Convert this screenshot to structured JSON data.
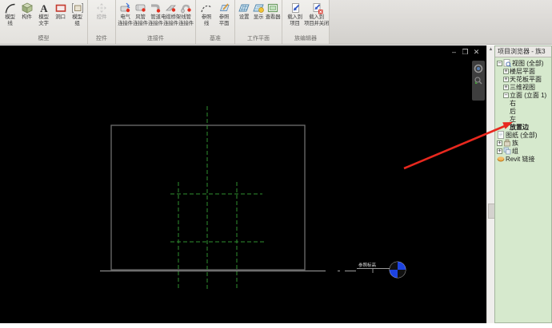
{
  "colors": {
    "annotation_red": "#e8281e",
    "reference_plane_green": "#2f8f2f",
    "geometry_gray": "#6f6f6f",
    "level_line_gray": "#8a8a8a",
    "level_head_blue": "#1d43e0",
    "canvas_background": "#000000",
    "browser_background": "#d6e9cd"
  },
  "ribbon": {
    "panels": [
      {
        "label": "模型",
        "buttons": [
          {
            "icon": "model-line",
            "lines": [
              "模型",
              "线"
            ]
          },
          {
            "icon": "component",
            "lines": [
              "构件"
            ]
          },
          {
            "icon": "model-text",
            "lines": [
              "模型",
              "文字"
            ]
          },
          {
            "icon": "opening",
            "lines": [
              "洞口"
            ]
          },
          {
            "icon": "model-group",
            "lines": [
              "模型",
              "组"
            ]
          }
        ]
      },
      {
        "label": "控件",
        "buttons": [
          {
            "icon": "control",
            "lines": [
              "控件"
            ],
            "disabled": true
          }
        ]
      },
      {
        "label": "连接件",
        "buttons": [
          {
            "icon": "elec-connector",
            "lines": [
              "电气",
              "连接件"
            ]
          },
          {
            "icon": "duct-connector",
            "lines": [
              "风管",
              "连接件"
            ]
          },
          {
            "icon": "pipe-connector",
            "lines": [
              "管道",
              "连接件"
            ]
          },
          {
            "icon": "cable-tray-connector",
            "lines": [
              "电缆桥架",
              "连接件"
            ]
          },
          {
            "icon": "conduit-connector",
            "lines": [
              "线管",
              "连接件"
            ]
          }
        ]
      },
      {
        "label": "基准",
        "buttons": [
          {
            "icon": "ref-line",
            "lines": [
              "参照",
              "线"
            ]
          },
          {
            "icon": "ref-plane",
            "lines": [
              "参照",
              "平面"
            ]
          }
        ]
      },
      {
        "label": "工作平面",
        "buttons": [
          {
            "icon": "wp-set",
            "lines": [
              "设置"
            ]
          },
          {
            "icon": "wp-show",
            "lines": [
              "显示"
            ]
          },
          {
            "icon": "wp-viewer",
            "lines": [
              "查看器"
            ]
          }
        ]
      },
      {
        "label": "族编辑器",
        "buttons": [
          {
            "icon": "load-project",
            "lines": [
              "载入到",
              "项目"
            ]
          },
          {
            "icon": "load-close",
            "lines": [
              "载入到",
              "项目并关闭"
            ]
          }
        ]
      }
    ]
  },
  "canvas": {
    "window_controls": [
      {
        "name": "minimize",
        "glyph": "–"
      },
      {
        "name": "restore",
        "glyph": "❐"
      },
      {
        "name": "close",
        "glyph": "✕"
      }
    ],
    "level": {
      "name": "参照标高"
    }
  },
  "browser": {
    "title": "项目浏览器 - 族3",
    "tree": [
      {
        "indent": 0,
        "expander": "minus",
        "icon": "views",
        "label": "视图 (全部)",
        "bold": false
      },
      {
        "indent": 1,
        "expander": "plus",
        "icon": null,
        "label": "楼层平面",
        "bold": false
      },
      {
        "indent": 1,
        "expander": "plus",
        "icon": null,
        "label": "天花板平面",
        "bold": false
      },
      {
        "indent": 1,
        "expander": "plus",
        "icon": null,
        "label": "三维视图",
        "bold": false
      },
      {
        "indent": 1,
        "expander": "minus",
        "icon": null,
        "label": "立面 (立面 1)",
        "bold": false
      },
      {
        "indent": 2,
        "expander": null,
        "icon": null,
        "label": "右",
        "bold": false
      },
      {
        "indent": 2,
        "expander": null,
        "icon": null,
        "label": "后",
        "bold": false
      },
      {
        "indent": 2,
        "expander": null,
        "icon": null,
        "label": "左",
        "bold": false
      },
      {
        "indent": 2,
        "expander": null,
        "icon": null,
        "label": "放置边",
        "bold": true
      },
      {
        "indent": 0,
        "expander": null,
        "icon": "sheet",
        "label": "图纸 (全部)",
        "bold": false
      },
      {
        "indent": 0,
        "expander": "plus",
        "icon": "family",
        "label": "族",
        "bold": false
      },
      {
        "indent": 0,
        "expander": "plus",
        "icon": "group",
        "label": "组",
        "bold": false
      },
      {
        "indent": 0,
        "expander": null,
        "icon": "link",
        "label": "Revit 链接",
        "bold": false
      }
    ]
  }
}
